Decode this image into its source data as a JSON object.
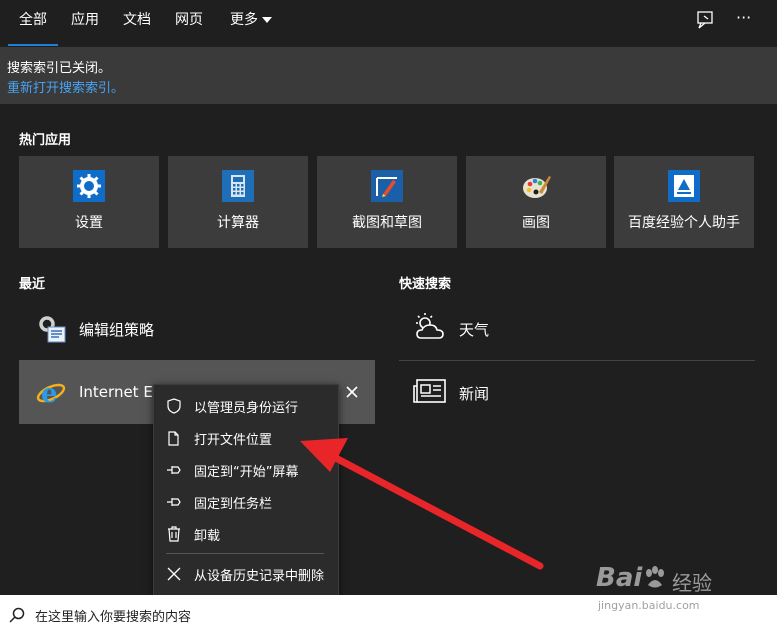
{
  "tabs": [
    {
      "label": "全部"
    },
    {
      "label": "应用"
    },
    {
      "label": "文档"
    },
    {
      "label": "网页"
    },
    {
      "label": "更多"
    }
  ],
  "notice": {
    "line1": "搜索索引已关闭。",
    "line2": "重新打开搜索索引。"
  },
  "hot_apps": {
    "heading": "热门应用",
    "items": [
      {
        "label": "设置"
      },
      {
        "label": "计算器"
      },
      {
        "label": "截图和草图"
      },
      {
        "label": "画图"
      },
      {
        "label": "百度经验个人助手"
      }
    ]
  },
  "recent": {
    "heading": "最近",
    "items": [
      {
        "label": "编辑组策略"
      },
      {
        "label": "Internet Ex"
      }
    ]
  },
  "quick_search": {
    "heading": "快速搜索",
    "items": [
      {
        "label": "天气"
      },
      {
        "label": "新闻"
      }
    ]
  },
  "context_menu": {
    "items": [
      {
        "label": "以管理员身份运行",
        "icon": "shield-icon"
      },
      {
        "label": "打开文件位置",
        "icon": "folder-icon"
      },
      {
        "label": "固定到“开始”屏幕",
        "icon": "pin-icon"
      },
      {
        "label": "固定到任务栏",
        "icon": "pin-icon"
      },
      {
        "label": "卸载",
        "icon": "trash-icon"
      },
      {
        "label": "从设备历史记录中删除",
        "icon": "close-icon"
      }
    ]
  },
  "search": {
    "placeholder": "在这里输入你要搜索的内容"
  },
  "watermark": {
    "brand": "Bai",
    "brand_cn": "经验",
    "url": "jingyan.baidu.com"
  },
  "colors": {
    "accent": "#1e7fd6",
    "link": "#4aa3f0",
    "arrow": "#e8262a"
  }
}
